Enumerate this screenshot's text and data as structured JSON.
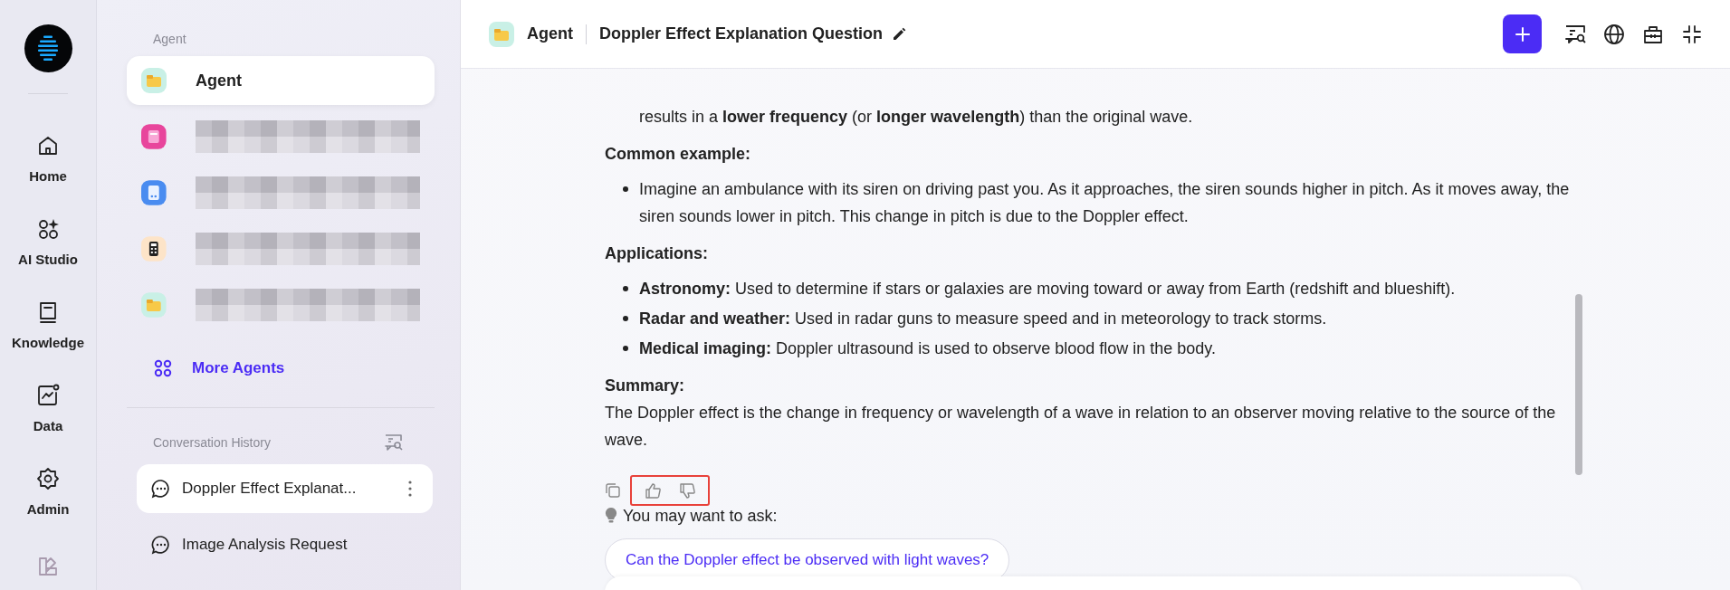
{
  "rail": {
    "items": [
      {
        "kind": "home",
        "label": "Home"
      },
      {
        "kind": "studio",
        "label": "AI Studio"
      },
      {
        "kind": "book",
        "label": "Knowledge"
      },
      {
        "kind": "chart",
        "label": "Data"
      },
      {
        "kind": "gear",
        "label": "Admin"
      }
    ]
  },
  "sidebar": {
    "agents_title": "Agent",
    "agents": [
      {
        "kind": "folder",
        "label": "Agent",
        "selected": true,
        "redacted": false
      },
      {
        "kind": "pink",
        "selected": false,
        "redacted": true
      },
      {
        "kind": "doc",
        "selected": false,
        "redacted": true
      },
      {
        "kind": "calc",
        "selected": false,
        "redacted": true
      },
      {
        "kind": "folder",
        "selected": false,
        "redacted": true
      }
    ],
    "more_agents": "More Agents",
    "history_title": "Conversation History",
    "conversations": [
      {
        "title": "Doppler Effect Explanat...",
        "selected": true
      },
      {
        "title": "Image Analysis Request",
        "selected": false
      }
    ]
  },
  "header": {
    "agent": "Agent",
    "title": "Doppler Effect Explanation Question",
    "actions": [
      {
        "kind": "plus"
      },
      {
        "kind": "search-chat"
      },
      {
        "kind": "globe"
      },
      {
        "kind": "toolbox"
      },
      {
        "kind": "collapse"
      }
    ]
  },
  "answer": {
    "blocks": [
      {
        "kind": "continuation",
        "text": "results in a **lower frequency** (or **longer wavelength**) than the original wave."
      },
      {
        "kind": "heading",
        "text": "Common example:"
      },
      {
        "kind": "bullets",
        "items": [
          "Imagine an ambulance with its siren on driving past you. As it approaches, the siren sounds higher in pitch. As it moves away, the siren sounds lower in pitch. This change in pitch is due to the Doppler effect."
        ]
      },
      {
        "kind": "heading",
        "text": "Applications:"
      },
      {
        "kind": "bullets",
        "items": [
          "**Astronomy:** Used to determine if stars or galaxies are moving toward or away from Earth (redshift and blueshift).",
          "**Radar and weather:** Used in radar guns to measure speed and in meteorology to track storms.",
          "**Medical imaging:** Doppler ultrasound is used to observe blood flow in the body."
        ]
      },
      {
        "kind": "heading",
        "text": "Summary:"
      },
      {
        "kind": "paragraph",
        "text": "The Doppler effect is the change in frequency or wavelength of a wave in relation to an observer moving relative to the source of the wave."
      }
    ],
    "feedback": {
      "highlighted": true
    },
    "suggest_title": "You may want to ask:",
    "suggestions": [
      "Can the Doppler effect be observed with light waves?"
    ]
  }
}
